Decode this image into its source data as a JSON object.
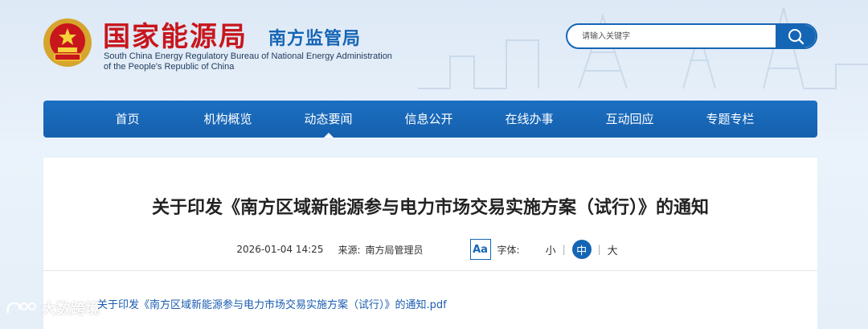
{
  "header": {
    "title_cn": "国家能源局",
    "subtitle_cn": "南方监管局",
    "title_en_line1": "South China Energy Regulatory Bureau of National Energy Administration",
    "title_en_line2": "of the People's Republic of China",
    "emblem_icon": "national-emblem-icon"
  },
  "search": {
    "placeholder": "请输入关键字",
    "button_icon": "search-icon"
  },
  "nav": {
    "items": [
      {
        "label": "首页"
      },
      {
        "label": "机构概览"
      },
      {
        "label": "动态要闻"
      },
      {
        "label": "信息公开"
      },
      {
        "label": "在线办事"
      },
      {
        "label": "互动回应"
      },
      {
        "label": "专题专栏"
      }
    ],
    "active_index": 2
  },
  "article": {
    "title": "关于印发《南方区域新能源参与电力市场交易实施方案（试行）》的通知",
    "date": "2026-01-04 14:25",
    "source_label": "来源:",
    "source": "南方局管理员",
    "font_icon_text": "Aa",
    "font_label": "字体:",
    "font_sizes": [
      "小",
      "中",
      "大"
    ],
    "font_size_selected": "中",
    "attachment": "关于印发《南方区域新能源参与电力市场交易实施方案（试行）》的通知.pdf"
  },
  "watermark": {
    "text": "大数跨境"
  },
  "colors": {
    "brand_blue": "#1565b5",
    "brand_red": "#c8161d"
  }
}
